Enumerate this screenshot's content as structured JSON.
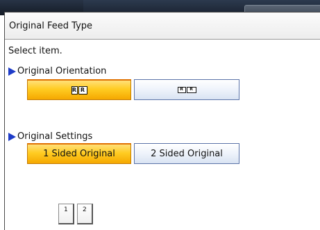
{
  "window": {
    "title": "Original Feed Type"
  },
  "prompt": "Select item.",
  "orientation": {
    "heading": "Original Orientation",
    "options": [
      {
        "icon": "readable-direction-icon",
        "glyph_front": "R",
        "glyph_back": "R",
        "selected": true
      },
      {
        "icon": "unreadable-direction-icon",
        "glyph_front": "R",
        "glyph_back": "R",
        "selected": false
      }
    ]
  },
  "settings": {
    "heading": "Original Settings",
    "one_sided": "1 Sided Original",
    "two_sided": "2 Sided Original",
    "selected": "1 Sided Original"
  },
  "preview": {
    "pages": [
      "1",
      "2"
    ]
  },
  "colors": {
    "selected": "#ffcc22",
    "unselected": "#e8eef8",
    "arrow": "#1e3cc8",
    "topbar": "#1f2938"
  }
}
